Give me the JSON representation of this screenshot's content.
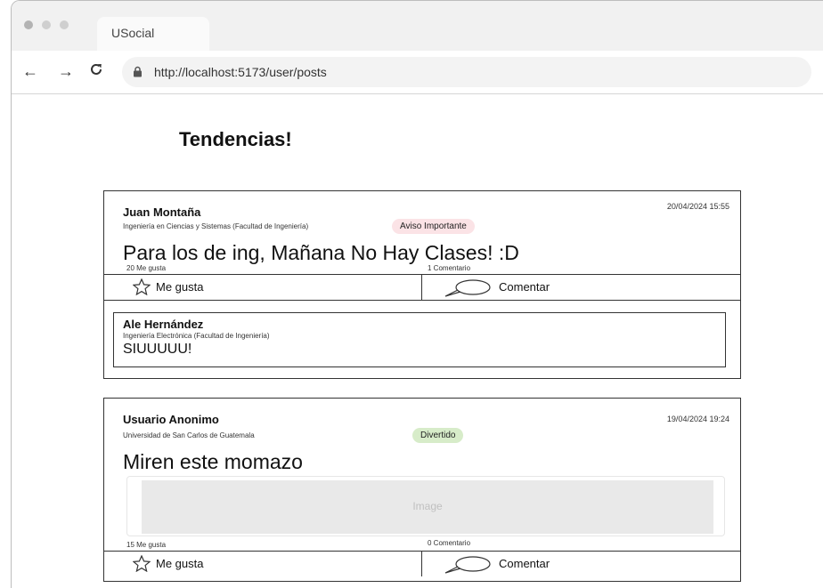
{
  "browser": {
    "tab_title": "USocial",
    "url": "http://localhost:5173/user/posts",
    "traffic_lights": [
      "#b3b3b3",
      "#cfcfcf",
      "#cfcfcf"
    ]
  },
  "page": {
    "heading": "Tendencias!"
  },
  "posts": [
    {
      "author": "Juan Montaña",
      "faculty": "Ingeniería en Ciencias y Sistemas (Facultad de Ingeniería)",
      "tag": "Aviso Importante",
      "date": "20/04/2024 15:55",
      "content": "Para los de ing, Mañana No Hay Clases! :D",
      "likes": "20 Me gusta",
      "comments": "1 Comentario",
      "like_label": "Me gusta",
      "comment_label": "Comentar",
      "replies": [
        {
          "author": "Ale Hernández",
          "faculty": "Ingeniería Electrónica (Facultad de Ingeniería)",
          "content": "SIUUUUU!"
        }
      ]
    },
    {
      "author": "Usuario Anonimo",
      "faculty": "Universidad de San Carlos de Guatemala",
      "tag": "Divertido",
      "date": "19/04/2024 19:24",
      "content": "Miren este momazo",
      "image_label": "Image",
      "likes": "15 Me gusta",
      "comments": "0 Comentario",
      "like_label": "Me gusta",
      "comment_label": "Comentar"
    }
  ]
}
